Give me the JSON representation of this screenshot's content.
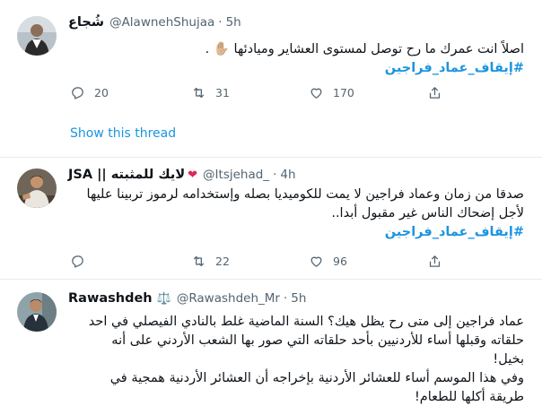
{
  "tweets": [
    {
      "name": "شُجاع",
      "handle": "@AlawnehShujaa",
      "dot": "·",
      "time": "5h",
      "text_line1": "اصلاً انت عمرك ما رح توصل لمستوى العشاير وميادئها ✋🏼 .",
      "hashtag": "#إيقاف_عماد_فراجين",
      "replies": "20",
      "retweets": "31",
      "likes": "170",
      "show_thread": "Show this thread"
    },
    {
      "name": "JSA",
      "name_prefix": "لايك للمثبته ||",
      "heart": "❤",
      "handle": "@Itsjehad_",
      "dot": "·",
      "time": "4h",
      "text_line1": "صدقا من زمان وعماد فراجين لا يمت للكوميديا بصله وإستخدامه لرموز تربينا عليها",
      "text_line2": "لأجل إضحاك الناس غير مقبول أبدا..",
      "hashtag": "#إيقاف_عماد_فراجين",
      "replies": "",
      "retweets": "22",
      "likes": "96"
    },
    {
      "name": "Rawashdeh",
      "badge": "⚖️",
      "handle": "@Rawashdeh_Mr",
      "dot": "·",
      "time": "5h",
      "text_line1": "عماد فراجين إلى متى رح يظل هيك؟ السنة الماضية غلط بالنادي الفيصلي في احد",
      "text_line2": "حلقاته وقبلها أساء للأردنيين بأحد حلقاته التي صور بها الشعب الأردني على أنه",
      "text_line3": "بخيل!",
      "text_line4": "وفي هذا الموسم أساء للعشائر الأردنية بإخراجه أن العشائر الأردنية همجية في",
      "text_line5": "طريقة أكلها للطعام!"
    }
  ],
  "icons": {
    "reply": "reply-icon",
    "retweet": "retweet-icon",
    "like": "heart-icon",
    "share": "share-icon"
  },
  "colors": {
    "link": "#1b95e0",
    "muted": "#536471",
    "divider": "#e6ecf0",
    "heart_red": "#e0245e"
  }
}
